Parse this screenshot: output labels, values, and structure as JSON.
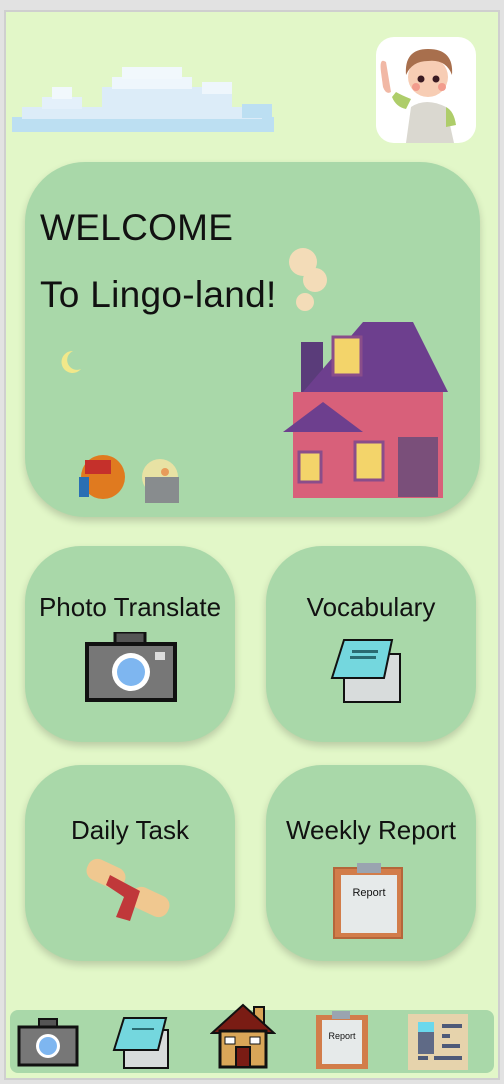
{
  "welcome": {
    "line1": "WELCOME",
    "line2": "To Lingo-land!"
  },
  "tiles": [
    {
      "label": "Photo Translate",
      "icon": "camera-icon"
    },
    {
      "label": "Vocabulary",
      "icon": "notepad-icon"
    },
    {
      "label": "Daily Task",
      "icon": "scroll-icon"
    },
    {
      "label": "Weekly Report",
      "icon": "report-clipboard-icon",
      "icon_text": "Report"
    }
  ],
  "nav": {
    "items": [
      {
        "icon": "camera-icon"
      },
      {
        "icon": "notepad-icon"
      },
      {
        "icon": "home-icon"
      },
      {
        "icon": "report-clipboard-icon",
        "icon_text": "Report"
      },
      {
        "icon": "profile-card-icon"
      }
    ]
  },
  "colors": {
    "background": "#e2f7c8",
    "card": "#a9d8a9"
  }
}
